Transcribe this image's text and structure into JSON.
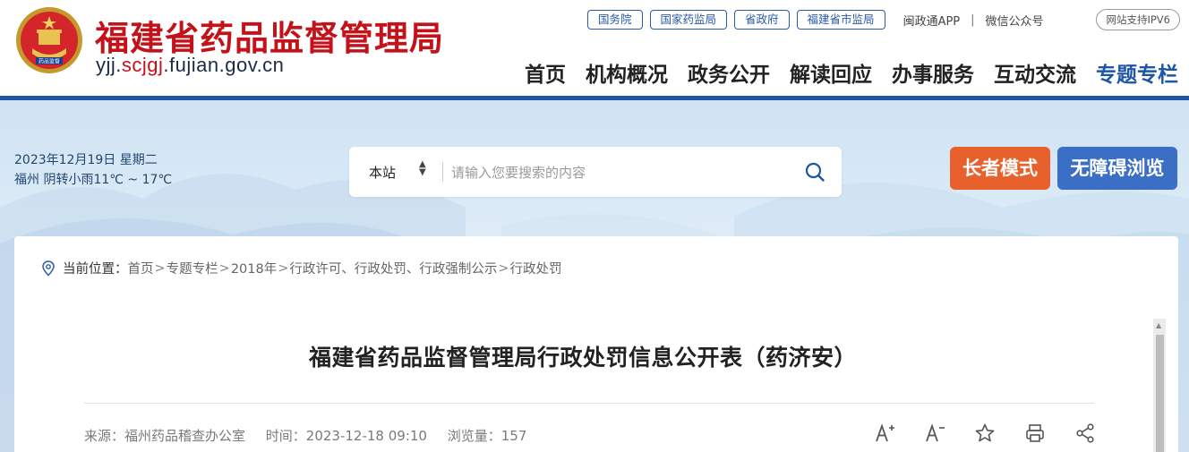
{
  "header": {
    "title": "福建省药品监督管理局",
    "domain_pre": "yjj.",
    "domain_hl": "scjgj",
    "domain_post": ".fujian.gov.cn",
    "emblem_text": "药品监督",
    "top_links": [
      "国务院",
      "国家药监局",
      "省政府",
      "福建省市监局"
    ],
    "app_link": "闽政通APP",
    "wechat_link": "微信公众号",
    "divider": "|",
    "ipv6": "网站支持IPV6",
    "nav": [
      "首页",
      "机构概况",
      "政务公开",
      "解读回应",
      "办事服务",
      "互动交流",
      "专题专栏"
    ],
    "brand_color": "#c4121b",
    "accent_color": "#1e56a7"
  },
  "banner": {
    "date": "2023年12月19日 星期二",
    "weather": "福州 阴转小雨11℃ ~ 17℃",
    "search_scope": "本站",
    "search_placeholder": "请输入您要搜索的内容",
    "elder_mode": "长者模式",
    "accessible": "无障碍浏览",
    "icons": {
      "scope": "updown-arrows-icon",
      "search": "search-icon"
    }
  },
  "breadcrumb": {
    "label": "当前位置：",
    "items": [
      "首页",
      "专题专栏",
      "2018年",
      "行政许可、行政处罚、行政强制公示",
      "行政处罚"
    ],
    "separator": ">"
  },
  "article": {
    "title": "福建省药品监督管理局行政处罚信息公开表（药济安）",
    "source": "来源：福州药品稽查办公室",
    "time": "时间：2023-12-18 09:10",
    "views": "浏览量：157",
    "tools": [
      "font-increase-icon",
      "font-decrease-icon",
      "favorite-star-icon",
      "print-icon",
      "share-icon"
    ],
    "tool_glyphs": [
      "A⁺",
      "A⁻",
      "☆",
      "⎙",
      "⋖"
    ]
  }
}
